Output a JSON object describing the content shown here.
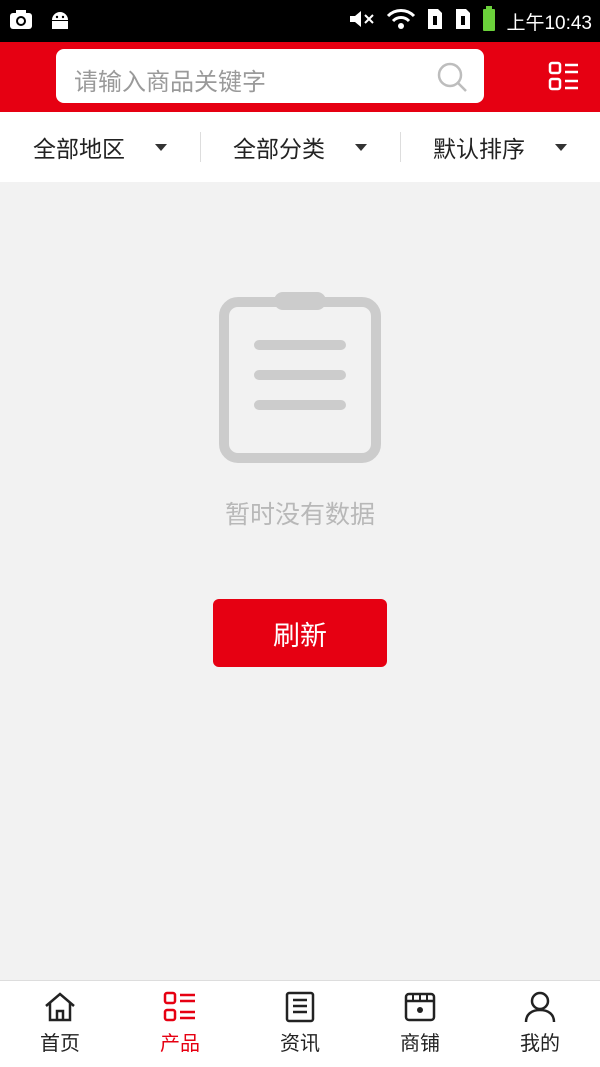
{
  "status_bar": {
    "time": "上午10:43"
  },
  "search": {
    "placeholder": "请输入商品关键字"
  },
  "filters": [
    {
      "label": "全部地区"
    },
    {
      "label": "全部分类"
    },
    {
      "label": "默认排序"
    }
  ],
  "empty_state": {
    "message": "暂时没有数据",
    "refresh_label": "刷新"
  },
  "tabs": [
    {
      "label": "首页",
      "icon": "home-icon",
      "active": false
    },
    {
      "label": "产品",
      "icon": "list-icon",
      "active": true
    },
    {
      "label": "资讯",
      "icon": "news-icon",
      "active": false
    },
    {
      "label": "商铺",
      "icon": "store-icon",
      "active": false
    },
    {
      "label": "我的",
      "icon": "user-icon",
      "active": false
    }
  ],
  "colors": {
    "brand": "#e60012",
    "background": "#f2f2f2"
  }
}
